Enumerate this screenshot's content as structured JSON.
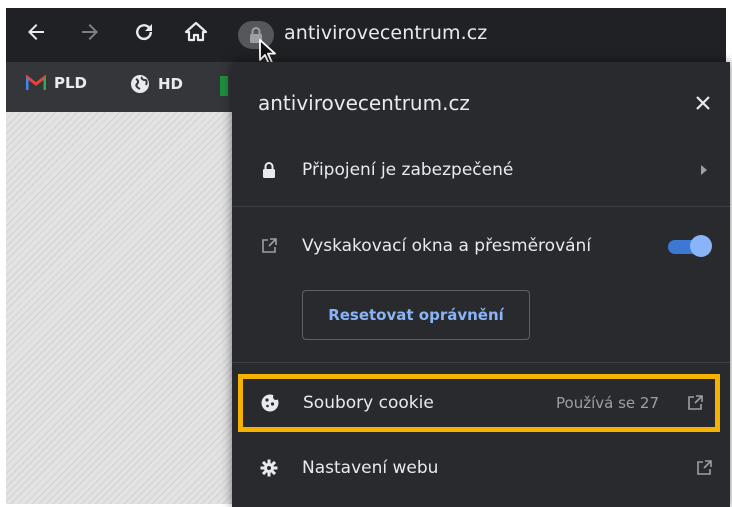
{
  "browser": {
    "url": "antivirovecentrum.cz",
    "bookmarks": [
      {
        "label": "PLD",
        "icon": "gmail-icon"
      },
      {
        "label": "HD",
        "icon": "globe-icon"
      }
    ]
  },
  "popup": {
    "title": "antivirovecentrum.cz",
    "connection_label": "Připojení je zabezpečené",
    "popups_label": "Vyskakovací okna a přesměrování",
    "popups_enabled": true,
    "reset_label": "Resetovat oprávnění",
    "cookies_label": "Soubory cookie",
    "cookies_status": "Používá se 27",
    "site_settings_label": "Nastavení webu"
  },
  "colors": {
    "highlight": "#f5b301",
    "accent": "#8ab4f8",
    "popup_bg": "#292a2d",
    "toolbar_bg": "#202124"
  }
}
